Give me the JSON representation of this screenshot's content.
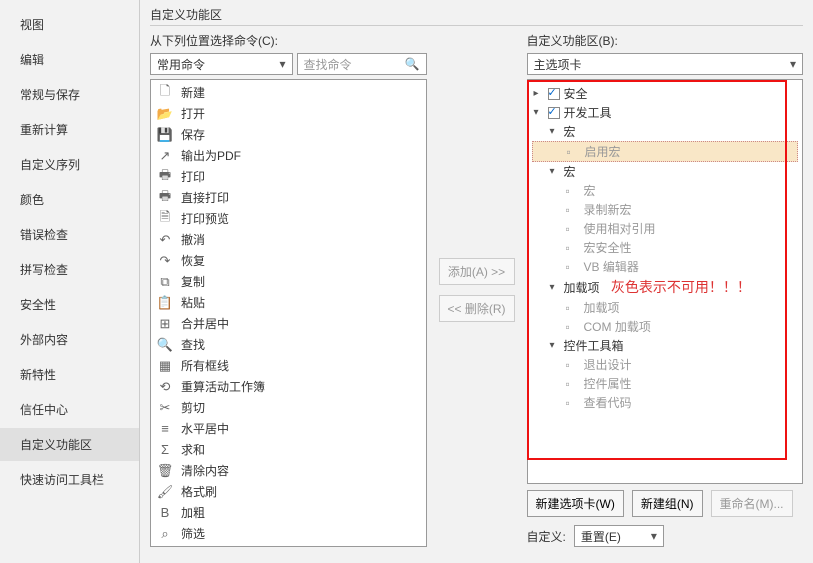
{
  "sidebar": {
    "items": [
      {
        "label": "视图"
      },
      {
        "label": "编辑"
      },
      {
        "label": "常规与保存"
      },
      {
        "label": "重新计算"
      },
      {
        "label": "自定义序列"
      },
      {
        "label": "颜色"
      },
      {
        "label": "错误检查"
      },
      {
        "label": "拼写检查"
      },
      {
        "label": "安全性"
      },
      {
        "label": "外部内容"
      },
      {
        "label": "新特性"
      },
      {
        "label": "信任中心"
      },
      {
        "label": "自定义功能区"
      },
      {
        "label": "快速访问工具栏"
      }
    ],
    "active_index": 12
  },
  "panel": {
    "title": "自定义功能区",
    "left_label": "从下列位置选择命令(C):",
    "right_label": "自定义功能区(B):",
    "left_combo": "常用命令",
    "right_combo": "主选项卡",
    "search_placeholder": "查找命令",
    "add_btn": "添加(A) >>",
    "remove_btn": "<< 删除(R)",
    "new_tab_btn": "新建选项卡(W)",
    "new_group_btn": "新建组(N)",
    "rename_btn": "重命名(M)...",
    "customize_label": "自定义:",
    "reset_btn": "重置(E)",
    "annotation": "灰色表示不可用！！！"
  },
  "commands": [
    {
      "icon": "🗋",
      "label": "新建"
    },
    {
      "icon": "📂",
      "label": "打开"
    },
    {
      "icon": "💾",
      "label": "保存"
    },
    {
      "icon": "↗",
      "label": "输出为PDF"
    },
    {
      "icon": "🖶",
      "label": "打印"
    },
    {
      "icon": "🖶",
      "label": "直接打印"
    },
    {
      "icon": "🗎",
      "label": "打印预览"
    },
    {
      "icon": "↶",
      "label": "撤消"
    },
    {
      "icon": "↷",
      "label": "恢复"
    },
    {
      "icon": "⧉",
      "label": "复制"
    },
    {
      "icon": "📋",
      "label": "粘贴"
    },
    {
      "icon": "⊞",
      "label": "合并居中"
    },
    {
      "icon": "🔍",
      "label": "查找"
    },
    {
      "icon": "▦",
      "label": "所有框线"
    },
    {
      "icon": "⟲",
      "label": "重算活动工作簿"
    },
    {
      "icon": "✂",
      "label": "剪切"
    },
    {
      "icon": "≡",
      "label": "水平居中"
    },
    {
      "icon": "Σ",
      "label": "求和"
    },
    {
      "icon": "🗑",
      "label": "清除内容"
    },
    {
      "icon": "🖌",
      "label": "格式刷"
    },
    {
      "icon": "B",
      "label": "加粗"
    },
    {
      "icon": "⌕",
      "label": "筛选"
    }
  ],
  "tree": {
    "root": [
      {
        "type": "top",
        "label": "安全",
        "checked": true,
        "expanded": false
      },
      {
        "type": "top",
        "label": "开发工具",
        "checked": true,
        "expanded": true,
        "children": [
          {
            "type": "group",
            "label": "宏",
            "expanded": true,
            "children": [
              {
                "type": "leaf",
                "label": "启用宏",
                "selected": true,
                "disabled": true
              }
            ]
          },
          {
            "type": "group",
            "label": "宏",
            "expanded": true,
            "children": [
              {
                "type": "leaf",
                "label": "宏",
                "disabled": true
              },
              {
                "type": "leaf",
                "label": "录制新宏",
                "disabled": true
              },
              {
                "type": "leaf",
                "label": "使用相对引用",
                "disabled": true
              },
              {
                "type": "leaf",
                "label": "宏安全性",
                "disabled": true
              },
              {
                "type": "leaf",
                "label": "VB 编辑器",
                "disabled": true
              }
            ]
          },
          {
            "type": "group",
            "label": "加载项",
            "expanded": true,
            "annot": true,
            "children": [
              {
                "type": "leaf",
                "label": "加载项",
                "disabled": true
              },
              {
                "type": "leaf",
                "label": "COM 加载项",
                "disabled": true
              }
            ]
          },
          {
            "type": "group",
            "label": "控件工具箱",
            "expanded": true,
            "children": [
              {
                "type": "leaf",
                "label": "退出设计",
                "disabled": true
              },
              {
                "type": "leaf",
                "label": "控件属性",
                "disabled": true
              },
              {
                "type": "leaf",
                "label": "查看代码",
                "disabled": true
              }
            ]
          }
        ]
      }
    ]
  }
}
